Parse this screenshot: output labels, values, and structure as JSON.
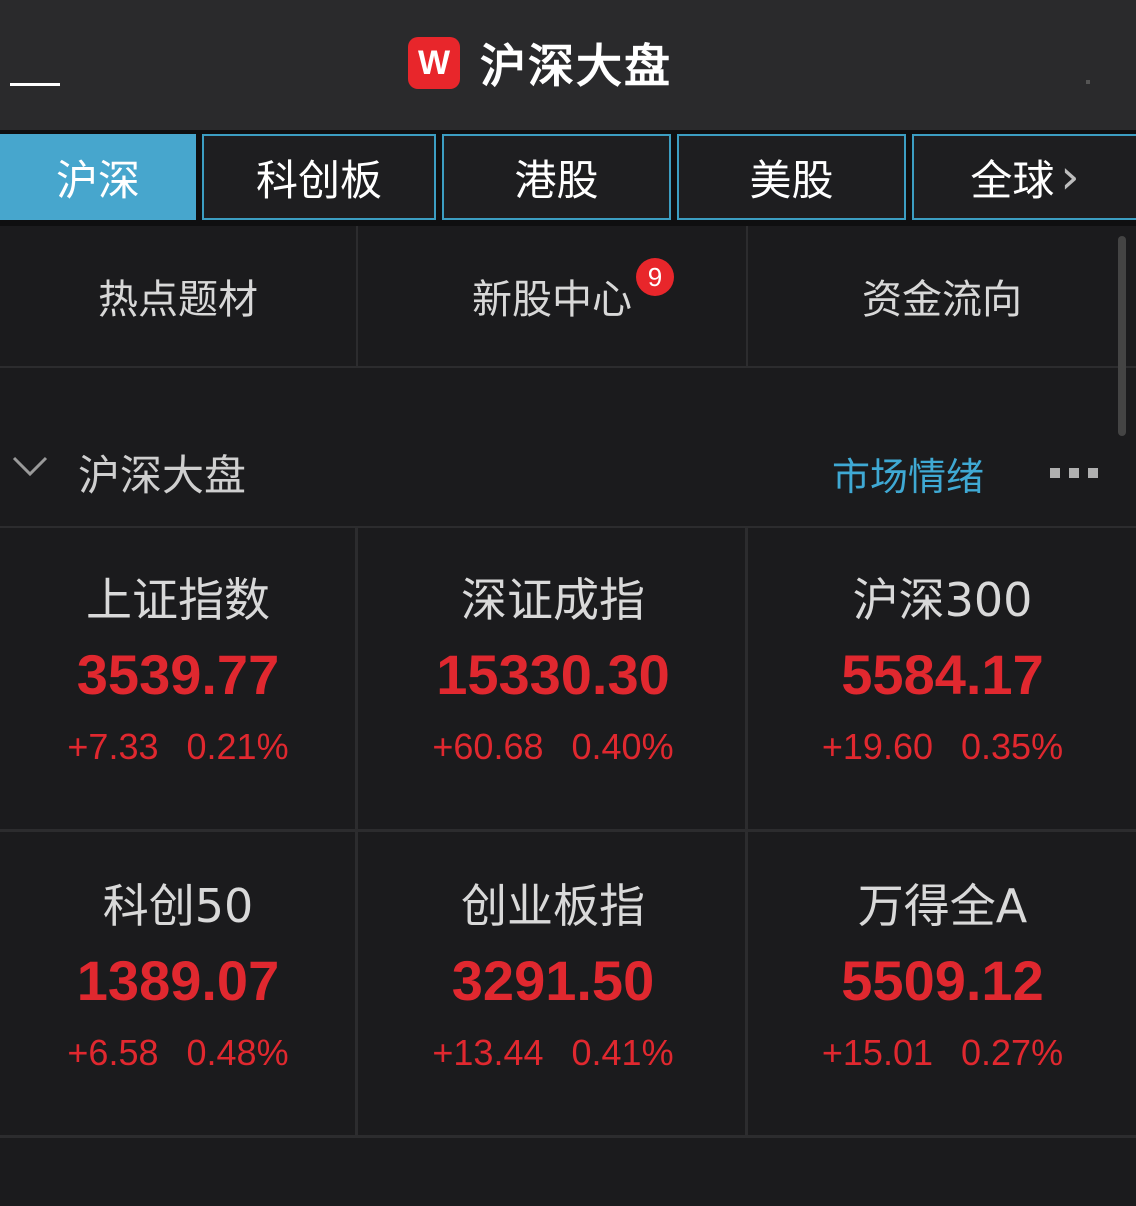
{
  "header": {
    "logo_text": "W",
    "title": "沪深大盘"
  },
  "tabs": [
    {
      "label": "沪深",
      "active": true
    },
    {
      "label": "科创板",
      "active": false
    },
    {
      "label": "港股",
      "active": false
    },
    {
      "label": "美股",
      "active": false
    },
    {
      "label": "全球",
      "active": false
    }
  ],
  "tab_more_glyph": "›",
  "quick_links": [
    {
      "label": "热点题材"
    },
    {
      "label": "新股中心",
      "badge": "9"
    },
    {
      "label": "资金流向"
    }
  ],
  "section": {
    "title": "沪深大盘",
    "link": "市场情绪"
  },
  "indices": [
    {
      "name": "上证指数",
      "value": "3539.77",
      "change": "+7.33",
      "pct": "0.21%"
    },
    {
      "name": "深证成指",
      "value": "15330.30",
      "change": "+60.68",
      "pct": "0.40%"
    },
    {
      "name": "沪深300",
      "value": "5584.17",
      "change": "+19.60",
      "pct": "0.35%"
    },
    {
      "name": "科创50",
      "value": "1389.07",
      "change": "+6.58",
      "pct": "0.48%"
    },
    {
      "name": "创业板指",
      "value": "3291.50",
      "change": "+13.44",
      "pct": "0.41%"
    },
    {
      "name": "万得全A",
      "value": "5509.12",
      "change": "+15.01",
      "pct": "0.27%"
    }
  ],
  "colors": {
    "accent": "#47a6cd",
    "up": "#e0282f",
    "badge": "#e8262b"
  }
}
